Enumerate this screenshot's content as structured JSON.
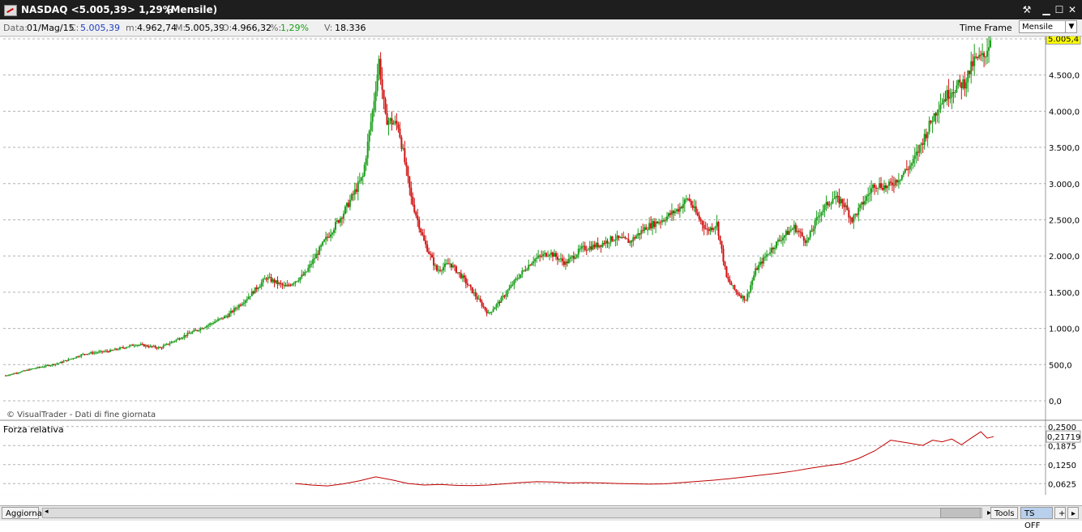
{
  "window": {
    "title": "NASDAQ <5.005,39> 1,29%",
    "mode": "(Mensile)",
    "buttons": {
      "tools": "⚒",
      "minimize": "▁",
      "maximize": "☐",
      "close": "✕"
    }
  },
  "info": {
    "date_label": "Data:",
    "date_value": "01/Mag/15",
    "close_label": "C:",
    "close_value": "5.005,39",
    "low_label": "m:",
    "low_value": "4.962,74",
    "high_label": "M:",
    "high_value": "5.005,39",
    "open_label": "O:",
    "open_value": "4.966,32",
    "pct_label": "%:",
    "pct_value": "1,29%",
    "vol_label": "V:",
    "vol_value": "18.336",
    "timeframe_label": "Time Frame",
    "timeframe_value": "Mensile"
  },
  "watermark": "© VisualTrader - Dati di fine giornata",
  "indicator_title": "Forza relativa",
  "bottom": {
    "refresh": "Aggiorna",
    "tools": "Tools",
    "ts": "TS OFF",
    "plus": "+",
    "arrow": "▸"
  },
  "colors": {
    "up": "#1a9e1a",
    "down": "#d01010",
    "rs_line": "#c00000",
    "price_tag": "#ffff00",
    "ts_bg": "#b8d0ec"
  },
  "chart_data": [
    {
      "type": "candlestick",
      "title": "NASDAQ",
      "ylim": [
        0,
        5100
      ],
      "yticks": [
        0,
        500,
        1000,
        1500,
        2000,
        2500,
        3000,
        3500,
        4000,
        4500,
        5000
      ],
      "ytick_labels": [
        "0,0",
        "500,0",
        "1.000,0",
        "1.500,0",
        "2.000,0",
        "2.500,0",
        "3.000,0",
        "3.500,0",
        "4.000,0",
        "4.500,0",
        "5.000,0"
      ],
      "last_price_label": "5.005,4",
      "last_price": 5005.4,
      "period": "monthly",
      "series_approx_key_points": [
        {
          "x": 0,
          "y": 350
        },
        {
          "x": 18,
          "y": 450
        },
        {
          "x": 33,
          "y": 520
        },
        {
          "x": 49,
          "y": 650
        },
        {
          "x": 65,
          "y": 690
        },
        {
          "x": 81,
          "y": 780
        },
        {
          "x": 96,
          "y": 730
        },
        {
          "x": 111,
          "y": 900
        },
        {
          "x": 126,
          "y": 1050
        },
        {
          "x": 138,
          "y": 1180
        },
        {
          "x": 150,
          "y": 1420
        },
        {
          "x": 162,
          "y": 1700
        },
        {
          "x": 174,
          "y": 1570
        },
        {
          "x": 186,
          "y": 1750
        },
        {
          "x": 198,
          "y": 2200
        },
        {
          "x": 210,
          "y": 2600
        },
        {
          "x": 222,
          "y": 3100
        },
        {
          "x": 228,
          "y": 4000
        },
        {
          "x": 232,
          "y": 4700
        },
        {
          "x": 236,
          "y": 3900
        },
        {
          "x": 244,
          "y": 3800
        },
        {
          "x": 252,
          "y": 2800
        },
        {
          "x": 260,
          "y": 2200
        },
        {
          "x": 268,
          "y": 1800
        },
        {
          "x": 276,
          "y": 1900
        },
        {
          "x": 284,
          "y": 1700
        },
        {
          "x": 292,
          "y": 1450
        },
        {
          "x": 300,
          "y": 1200
        },
        {
          "x": 308,
          "y": 1400
        },
        {
          "x": 318,
          "y": 1700
        },
        {
          "x": 328,
          "y": 1950
        },
        {
          "x": 338,
          "y": 2050
        },
        {
          "x": 348,
          "y": 1900
        },
        {
          "x": 358,
          "y": 2100
        },
        {
          "x": 368,
          "y": 2150
        },
        {
          "x": 378,
          "y": 2250
        },
        {
          "x": 388,
          "y": 2200
        },
        {
          "x": 398,
          "y": 2400
        },
        {
          "x": 408,
          "y": 2500
        },
        {
          "x": 418,
          "y": 2650
        },
        {
          "x": 424,
          "y": 2800
        },
        {
          "x": 430,
          "y": 2550
        },
        {
          "x": 436,
          "y": 2350
        },
        {
          "x": 442,
          "y": 2450
        },
        {
          "x": 448,
          "y": 1700
        },
        {
          "x": 454,
          "y": 1500
        },
        {
          "x": 460,
          "y": 1400
        },
        {
          "x": 466,
          "y": 1800
        },
        {
          "x": 474,
          "y": 2050
        },
        {
          "x": 482,
          "y": 2250
        },
        {
          "x": 490,
          "y": 2400
        },
        {
          "x": 498,
          "y": 2200
        },
        {
          "x": 506,
          "y": 2600
        },
        {
          "x": 514,
          "y": 2800
        },
        {
          "x": 520,
          "y": 2750
        },
        {
          "x": 526,
          "y": 2500
        },
        {
          "x": 532,
          "y": 2700
        },
        {
          "x": 540,
          "y": 3000
        },
        {
          "x": 548,
          "y": 2950
        },
        {
          "x": 556,
          "y": 3100
        },
        {
          "x": 564,
          "y": 3300
        },
        {
          "x": 572,
          "y": 3700
        },
        {
          "x": 580,
          "y": 4100
        },
        {
          "x": 588,
          "y": 4300
        },
        {
          "x": 596,
          "y": 4400
        },
        {
          "x": 602,
          "y": 4700
        },
        {
          "x": 608,
          "y": 4750
        },
        {
          "x": 612,
          "y": 5005
        }
      ]
    },
    {
      "type": "line",
      "title": "Forza relativa",
      "ylim": [
        0.05,
        0.26
      ],
      "yticks": [
        0.0625,
        0.125,
        0.1875,
        0.25
      ],
      "ytick_labels": [
        "0,0625",
        "0,1250",
        "0,1875",
        "0,2500"
      ],
      "last_value_label": "0,21719",
      "last_value": 0.21719,
      "series": [
        {
          "values": [
            {
              "x": 180,
              "y": 0.063
            },
            {
              "x": 190,
              "y": 0.058
            },
            {
              "x": 200,
              "y": 0.055
            },
            {
              "x": 210,
              "y": 0.062
            },
            {
              "x": 220,
              "y": 0.072
            },
            {
              "x": 230,
              "y": 0.085
            },
            {
              "x": 240,
              "y": 0.075
            },
            {
              "x": 250,
              "y": 0.063
            },
            {
              "x": 260,
              "y": 0.058
            },
            {
              "x": 270,
              "y": 0.06
            },
            {
              "x": 280,
              "y": 0.057
            },
            {
              "x": 290,
              "y": 0.056
            },
            {
              "x": 300,
              "y": 0.058
            },
            {
              "x": 310,
              "y": 0.062
            },
            {
              "x": 320,
              "y": 0.066
            },
            {
              "x": 330,
              "y": 0.069
            },
            {
              "x": 340,
              "y": 0.068
            },
            {
              "x": 350,
              "y": 0.065
            },
            {
              "x": 360,
              "y": 0.066
            },
            {
              "x": 370,
              "y": 0.065
            },
            {
              "x": 380,
              "y": 0.063
            },
            {
              "x": 390,
              "y": 0.062
            },
            {
              "x": 400,
              "y": 0.061
            },
            {
              "x": 410,
              "y": 0.062
            },
            {
              "x": 420,
              "y": 0.066
            },
            {
              "x": 430,
              "y": 0.07
            },
            {
              "x": 440,
              "y": 0.074
            },
            {
              "x": 450,
              "y": 0.079
            },
            {
              "x": 460,
              "y": 0.085
            },
            {
              "x": 470,
              "y": 0.091
            },
            {
              "x": 480,
              "y": 0.097
            },
            {
              "x": 490,
              "y": 0.104
            },
            {
              "x": 500,
              "y": 0.113
            },
            {
              "x": 510,
              "y": 0.121
            },
            {
              "x": 520,
              "y": 0.128
            },
            {
              "x": 530,
              "y": 0.145
            },
            {
              "x": 540,
              "y": 0.17
            },
            {
              "x": 550,
              "y": 0.205
            },
            {
              "x": 560,
              "y": 0.197
            },
            {
              "x": 570,
              "y": 0.188
            },
            {
              "x": 576,
              "y": 0.205
            },
            {
              "x": 582,
              "y": 0.2
            },
            {
              "x": 588,
              "y": 0.209
            },
            {
              "x": 594,
              "y": 0.19
            },
            {
              "x": 600,
              "y": 0.212
            },
            {
              "x": 606,
              "y": 0.233
            },
            {
              "x": 610,
              "y": 0.212
            },
            {
              "x": 614,
              "y": 0.217
            }
          ]
        }
      ]
    }
  ]
}
